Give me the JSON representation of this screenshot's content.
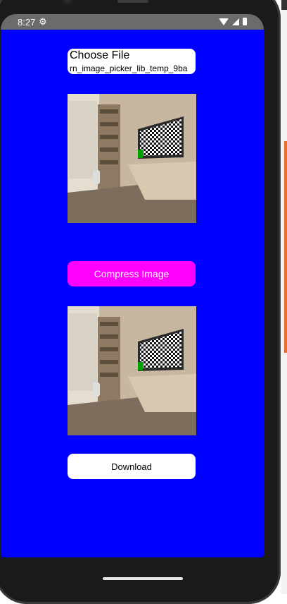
{
  "status_bar": {
    "time": "8:27",
    "settings_icon": "gear-icon",
    "icons": [
      "wifi-icon",
      "cell-signal-icon",
      "battery-icon"
    ]
  },
  "file_chooser": {
    "label": "Choose File",
    "file_name": "rn_image_picker_lib_temp_9ba"
  },
  "original_image": {
    "description_icon": "room-photo-image"
  },
  "compress_button": {
    "label": "Compress Image",
    "color": "#ff00ff"
  },
  "compressed_image": {
    "description_icon": "room-photo-image"
  },
  "download_button": {
    "label": "Download"
  },
  "colors": {
    "screen_background": "#0000ff",
    "status_bar": "#6b6b6b"
  }
}
